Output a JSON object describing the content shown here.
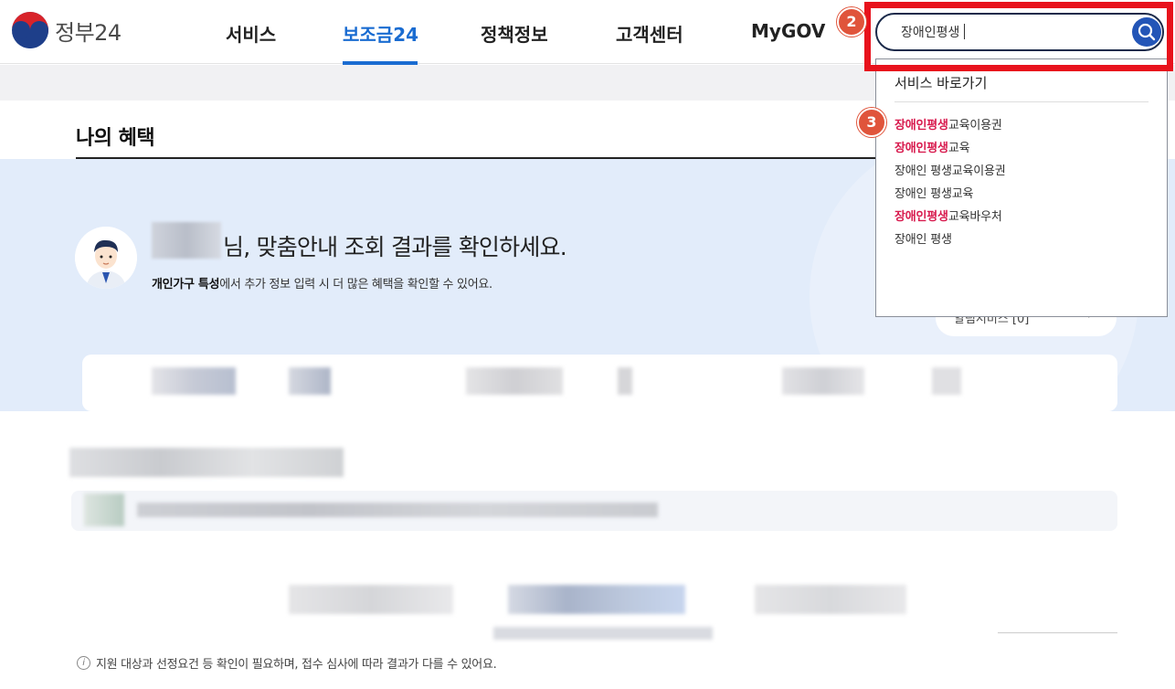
{
  "header": {
    "logo_text": "정부24",
    "nav": [
      {
        "label": "서비스"
      },
      {
        "label": "보조금24"
      },
      {
        "label": "정책정보"
      },
      {
        "label": "고객센터"
      },
      {
        "label": "MyGOV"
      }
    ],
    "active_nav": "보조금24"
  },
  "search": {
    "value": "장애인평생",
    "dropdown": {
      "heading": "서비스 바로가기",
      "items": [
        {
          "highlight": "장애인평생",
          "rest": "교육이용권"
        },
        {
          "highlight": "장애인평생",
          "rest": "교육"
        },
        {
          "highlight": "",
          "rest": "장애인 평생교육이용권"
        },
        {
          "highlight": "",
          "rest": "장애인 평생교육"
        },
        {
          "highlight": "장애인평생",
          "rest": "교육바우처"
        },
        {
          "highlight": "",
          "rest": "장애인 평생"
        }
      ]
    }
  },
  "annotations": {
    "badge_search": "2",
    "badge_item": "3"
  },
  "main": {
    "title": "나의 혜택",
    "greeting": "님, 맞춤안내 조회 결과를 확인하세요.",
    "sub_bold": "개인가구 특성",
    "sub_rest": "에서 추가 정보 입력 시 더 많은 혜택을 확인할 수 있어요.",
    "pill_text": "알림서비스 [0]",
    "notice": "지원 대상과 선정요건 등 확인이 필요하며, 접수 심사에 따라 결과가 다를 수 있어요."
  },
  "colors": {
    "accent": "#1a6cd1",
    "highlight": "#d81c4f",
    "badge": "#e0543b",
    "frame": "#e8121c"
  }
}
